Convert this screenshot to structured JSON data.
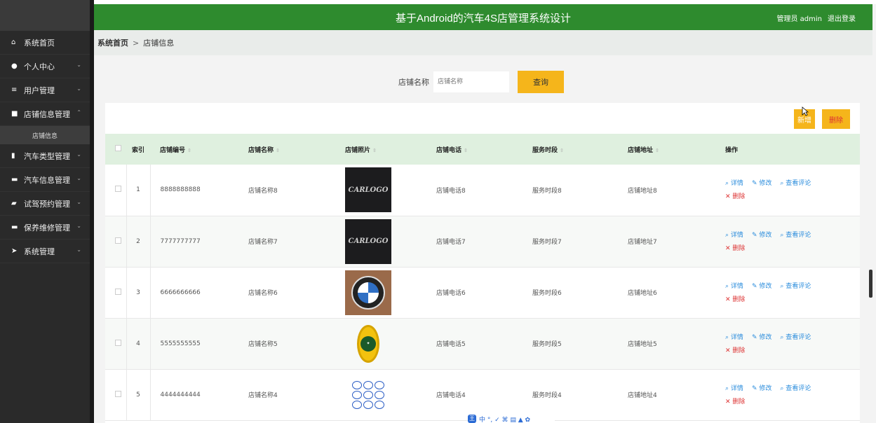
{
  "header": {
    "title": "基于Android的汽车4S店管理系统设计",
    "admin": "管理员 admin",
    "logout": "退出登录"
  },
  "sidebar": {
    "items": [
      {
        "label": "系统首页",
        "icon": "home-icon"
      },
      {
        "label": "个人中心",
        "icon": "user-icon"
      },
      {
        "label": "用户管理",
        "icon": "list-icon"
      },
      {
        "label": "店铺信息管理",
        "icon": "folder-icon"
      },
      {
        "label": "汽车类型管理",
        "icon": "bar-chart-icon"
      },
      {
        "label": "汽车信息管理",
        "icon": "monitor-icon"
      },
      {
        "label": "试驾预约管理",
        "icon": "briefcase-icon"
      },
      {
        "label": "保养维修管理",
        "icon": "monitor-icon"
      },
      {
        "label": "系统管理",
        "icon": "send-icon"
      }
    ],
    "sub_item": "店铺信息"
  },
  "breadcrumb": {
    "home": "系统首页",
    "sep": ">",
    "current": "店铺信息"
  },
  "search": {
    "label": "店铺名称",
    "placeholder": "店铺名称",
    "button": "查询"
  },
  "toolbar": {
    "add": "新增",
    "delete": "删除"
  },
  "table": {
    "headers": {
      "index": "索引",
      "code": "店铺编号",
      "name": "店铺名称",
      "photo": "店铺照片",
      "phone": "店铺电话",
      "hours": "服务时段",
      "address": "店铺地址",
      "actions": "操作"
    },
    "op_labels": {
      "detail": "详情",
      "edit": "修改",
      "comments": "查看评论",
      "delete": "删除"
    },
    "rows": [
      {
        "index": "1",
        "code": "8888888888",
        "name": "店铺名称8",
        "photo": "CARLOGO",
        "phone": "店铺电话8",
        "hours": "服务时段8",
        "address": "店铺地址8"
      },
      {
        "index": "2",
        "code": "7777777777",
        "name": "店铺名称7",
        "photo": "CARLOGO",
        "phone": "店铺电话7",
        "hours": "服务时段7",
        "address": "店铺地址7"
      },
      {
        "index": "3",
        "code": "6666666666",
        "name": "店铺名称6",
        "photo": "BMW",
        "phone": "店铺电话6",
        "hours": "服务时段6",
        "address": "店铺地址6"
      },
      {
        "index": "4",
        "code": "5555555555",
        "name": "店铺名称5",
        "photo": "LOTUS",
        "phone": "店铺电话5",
        "hours": "服务时段5",
        "address": "店铺地址5"
      },
      {
        "index": "5",
        "code": "4444444444",
        "name": "店铺名称4",
        "photo": "",
        "phone": "店铺电话4",
        "hours": "服务时段4",
        "address": "店铺地址4"
      }
    ]
  },
  "ime": {
    "logo": "王",
    "text": "中 °, ✓ ⌘ ▤ ▲ ✿"
  },
  "colors": {
    "header": "#2e8b2e",
    "accent": "#f5b51b",
    "link": "#2a8cdc",
    "danger": "#d33333",
    "sidebar": "#2a2a2a"
  }
}
